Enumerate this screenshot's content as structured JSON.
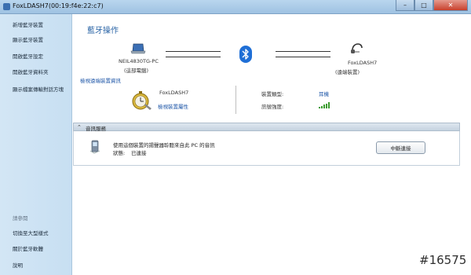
{
  "window": {
    "title": "FoxLDASH7(00:19:f4e:22:c7)",
    "min_glyph": "–",
    "max_glyph": "□",
    "close_glyph": "✕"
  },
  "sidebar": {
    "items": [
      {
        "label": "新增藍牙裝置"
      },
      {
        "label": "顯示藍牙裝置"
      },
      {
        "label": "開啟藍牙設定"
      },
      {
        "label": "開啟藍牙資料夾"
      },
      {
        "label": "顯示檔案傳輸對話方塊"
      }
    ],
    "see_also_heading": "請參閱",
    "see_also_items": [
      {
        "label": "切換至大型樣式"
      },
      {
        "label": "關於藍牙軟體"
      },
      {
        "label": "說明"
      }
    ]
  },
  "main": {
    "title": "藍牙操作",
    "local_device": {
      "name": "NEIL4830TG-PC",
      "role": "(這部電腦)"
    },
    "remote_device": {
      "name": "FoxLDASH7",
      "role": "(遠端裝置)"
    },
    "view_remote_info_link": "檢視遠端裝置資訊",
    "device_card": {
      "name": "FoxLDASH7",
      "properties_link": "檢視裝置屬性",
      "device_type_label": "裝置類型:",
      "device_type_value": "耳機",
      "signal_label": "訊號強度:",
      "signal_bars": 5,
      "signal_color": "#3c9c2f"
    },
    "service_panel": {
      "header": "音訊服務",
      "description": "使用這個裝置的揚聲器聆聽來自此 PC 的音訊",
      "status_label": "狀態:",
      "status_value": "已連接",
      "disconnect_button": "中斷連接"
    }
  },
  "watermark": "#16575",
  "colors": {
    "title_blue": "#2a64a6",
    "link_blue": "#1f57a8",
    "bluetooth": "#1f6fd6"
  }
}
